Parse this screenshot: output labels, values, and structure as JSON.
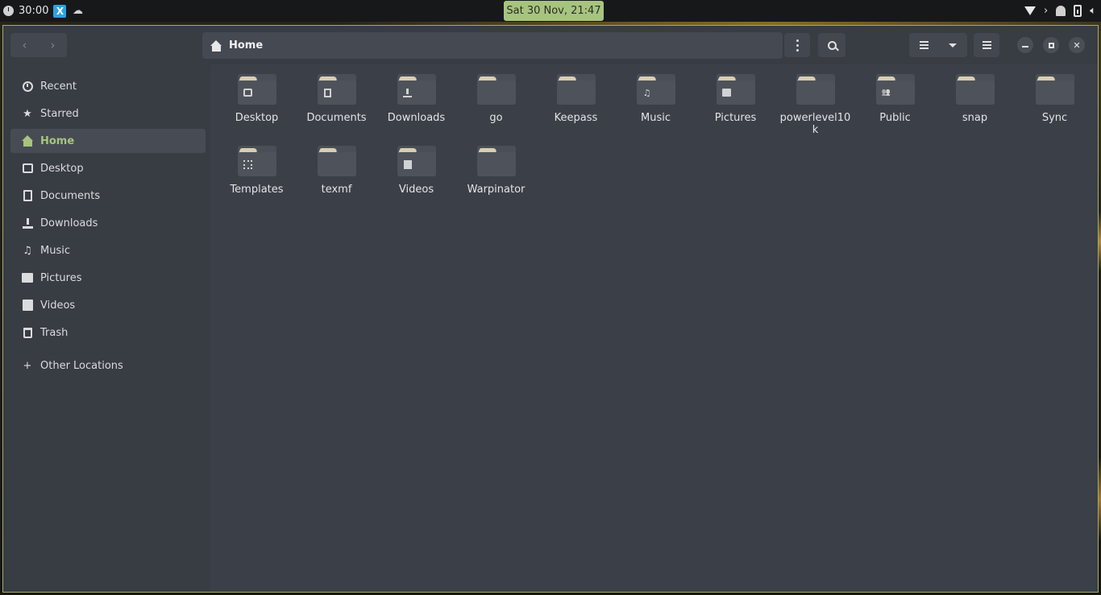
{
  "topbar": {
    "timer": "30:00",
    "clock": "Sat 30 Nov, 21:47",
    "app1_glyph": "X",
    "arrow_glyph": "›"
  },
  "header": {
    "back_glyph": "‹",
    "forward_glyph": "›",
    "path_label": "Home",
    "close_glyph": "✕"
  },
  "sidebar": {
    "items": [
      {
        "label": "Recent",
        "icon": "clock-icon"
      },
      {
        "label": "Starred",
        "icon": "star-icon"
      },
      {
        "label": "Home",
        "icon": "home-icon",
        "active": true
      },
      {
        "label": "Desktop",
        "icon": "desktop-icon"
      },
      {
        "label": "Documents",
        "icon": "document-icon"
      },
      {
        "label": "Downloads",
        "icon": "download-icon"
      },
      {
        "label": "Music",
        "icon": "music-icon"
      },
      {
        "label": "Pictures",
        "icon": "picture-icon"
      },
      {
        "label": "Videos",
        "icon": "video-icon"
      },
      {
        "label": "Trash",
        "icon": "trash-icon"
      }
    ],
    "other_locations": "Other Locations",
    "star_glyph": "★",
    "music_glyph": "♫",
    "plus_glyph": "+"
  },
  "folders": [
    {
      "label": "Desktop",
      "emblem": "desktop"
    },
    {
      "label": "Documents",
      "emblem": "document"
    },
    {
      "label": "Downloads",
      "emblem": "download"
    },
    {
      "label": "go",
      "emblem": ""
    },
    {
      "label": "Keepass",
      "emblem": ""
    },
    {
      "label": "Music",
      "emblem": "music"
    },
    {
      "label": "Pictures",
      "emblem": "picture"
    },
    {
      "label": "powerlevel10k",
      "emblem": ""
    },
    {
      "label": "Public",
      "emblem": "public"
    },
    {
      "label": "snap",
      "emblem": ""
    },
    {
      "label": "Sync",
      "emblem": ""
    },
    {
      "label": "Templates",
      "emblem": "template"
    },
    {
      "label": "texmf",
      "emblem": ""
    },
    {
      "label": "Videos",
      "emblem": "video"
    },
    {
      "label": "Warpinator",
      "emblem": ""
    }
  ],
  "emblem_glyphs": {
    "music": "♫",
    "public": "👥"
  },
  "colors": {
    "accent": "#a7c47f",
    "window_bg": "#383c43",
    "content_bg": "#3b4048",
    "folder_tab": "#d9cdb3"
  }
}
